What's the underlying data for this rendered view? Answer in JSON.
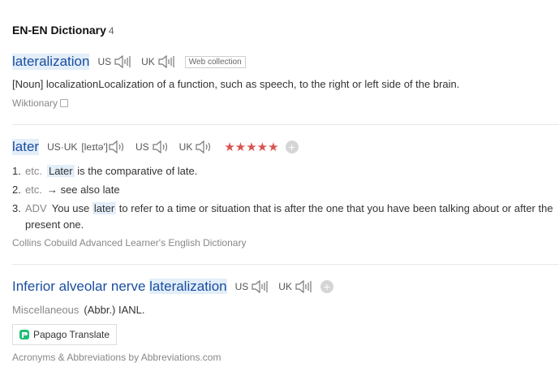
{
  "section": {
    "title": "EN-EN Dictionary",
    "count": "4"
  },
  "entries": [
    {
      "headword": "lateralization",
      "us_label": "US",
      "uk_label": "UK",
      "tag": "Web collection",
      "definition": "[Noun] localizationLocalization of a function, such as speech, to the right or left side of the brain.",
      "source": "Wiktionary"
    },
    {
      "headword": "later",
      "pron_label": "US·UK",
      "ipa": "[leɪtə']",
      "us_label": "US",
      "uk_label": "UK",
      "stars": "★★★★★",
      "add": "+",
      "senses": [
        {
          "num": "1.",
          "pos": "etc.",
          "hl": "Later",
          "text": "is the comparative of late."
        },
        {
          "num": "2.",
          "pos": "etc.",
          "text": "→ see also late"
        },
        {
          "num": "3.",
          "pos": "ADV",
          "pre": "You use",
          "hl": "later",
          "text": "to refer to a time or situation that is after the one that you have been talking about or after the present one."
        }
      ],
      "source": "Collins Cobuild Advanced Learner's English Dictionary"
    },
    {
      "headword_pre": "Inferior alveolar nerve",
      "headword_hl": "lateralization",
      "us_label": "US",
      "uk_label": "UK",
      "add": "+",
      "misc_label": "Miscellaneous",
      "definition": "(Abbr.) IANL.",
      "papago_label": "Papago Translate",
      "source": "Acronyms & Abbreviations by Abbreviations.com"
    }
  ],
  "colors": {
    "headword": "#1a4ea0",
    "highlight": "#e3eef9",
    "stars": "#d9534f"
  },
  "icons": {
    "speaker": "speaker-icon",
    "copy": "copy-icon",
    "add": "plus-icon",
    "papago": "papago-icon"
  }
}
